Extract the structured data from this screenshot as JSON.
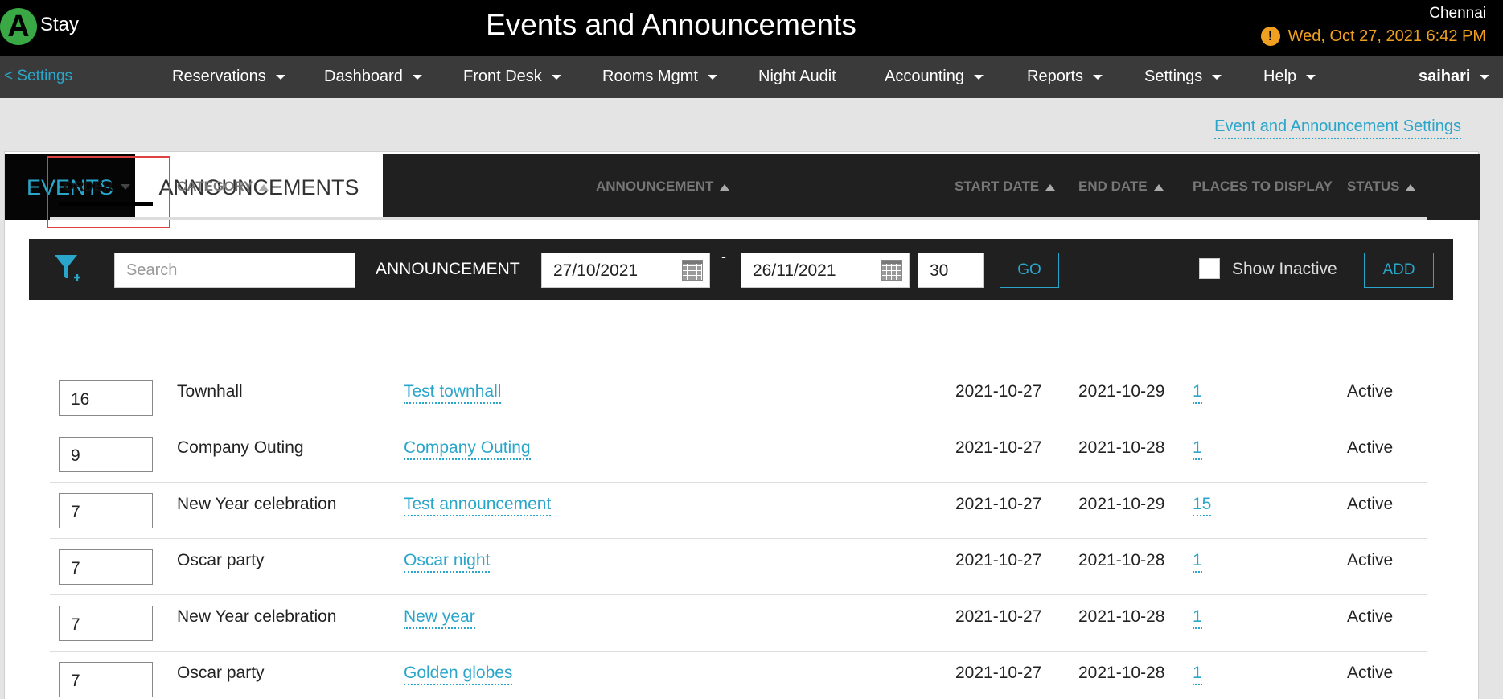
{
  "header": {
    "logo_letter": "A",
    "logo_text": "Stay",
    "title": "Events and Announcements",
    "location": "Chennai",
    "datetime": "Wed, Oct 27, 2021 6:42 PM",
    "warn_glyph": "!"
  },
  "nav": {
    "back_label": "< Settings",
    "items": [
      "Reservations",
      "Dashboard",
      "Front Desk",
      "Rooms Mgmt",
      "Night Audit",
      "Accounting",
      "Reports",
      "Settings",
      "Help"
    ],
    "user": "saihari"
  },
  "settings_link": "Event and Announcement Settings",
  "tabs": {
    "events": "EVENTS",
    "announcements": "ANNOUNCEMENTS"
  },
  "toolbar": {
    "search_placeholder": "Search",
    "type_label": "ANNOUNCEMENT",
    "date_from": "27/10/2021",
    "date_sep": "-",
    "date_to": "26/11/2021",
    "days": "30",
    "go_label": "GO",
    "show_inactive_label": "Show Inactive",
    "add_label": "ADD"
  },
  "table": {
    "headers": {
      "order": "ORDER",
      "category": "CATEGORY",
      "announcement": "ANNOUNCEMENT",
      "start_date": "START DATE",
      "end_date": "END DATE",
      "places": "PLACES TO DISPLAY",
      "status": "STATUS"
    },
    "rows": [
      {
        "order": "16",
        "category": "Townhall",
        "announcement": "Test townhall",
        "start": "2021-10-27",
        "end": "2021-10-29",
        "places": "1",
        "status": "Active"
      },
      {
        "order": "9",
        "category": "Company Outing",
        "announcement": "Company Outing",
        "start": "2021-10-27",
        "end": "2021-10-28",
        "places": "1",
        "status": "Active"
      },
      {
        "order": "7",
        "category": "New Year celebration",
        "announcement": "Test announcement",
        "start": "2021-10-27",
        "end": "2021-10-29",
        "places": "15",
        "status": "Active"
      },
      {
        "order": "7",
        "category": "Oscar party",
        "announcement": "Oscar night",
        "start": "2021-10-27",
        "end": "2021-10-28",
        "places": "1",
        "status": "Active"
      },
      {
        "order": "7",
        "category": "New Year celebration",
        "announcement": "New year",
        "start": "2021-10-27",
        "end": "2021-10-28",
        "places": "1",
        "status": "Active"
      },
      {
        "order": "7",
        "category": "Oscar party",
        "announcement": "Golden globes",
        "start": "2021-10-27",
        "end": "2021-10-28",
        "places": "1",
        "status": "Active"
      }
    ]
  },
  "colors": {
    "accent": "#2ba6cb",
    "warning": "#f0a020",
    "highlight": "#e04040"
  }
}
